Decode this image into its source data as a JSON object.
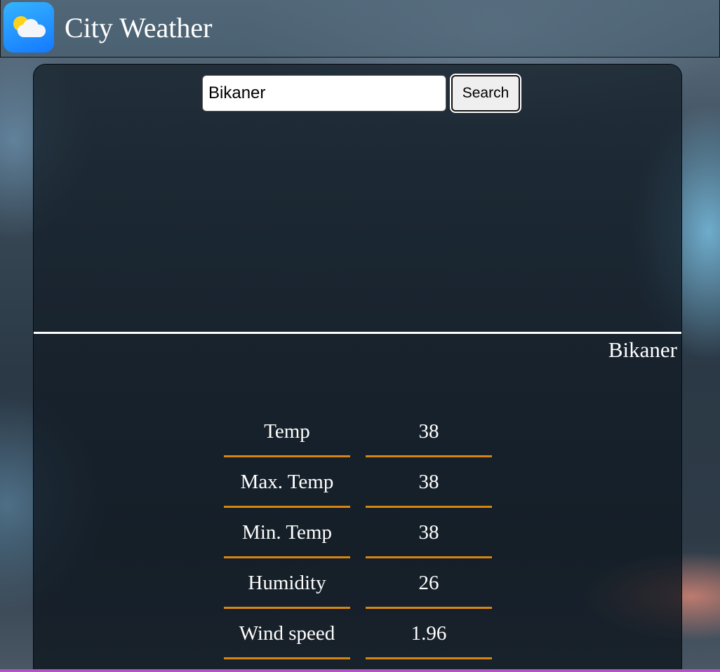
{
  "app": {
    "title": "City Weather"
  },
  "search": {
    "value": "Bikaner",
    "button_label": "Search"
  },
  "weather": {
    "city": "Bikaner",
    "rows": [
      {
        "label": "Temp",
        "value": "38"
      },
      {
        "label": "Max. Temp",
        "value": "38"
      },
      {
        "label": "Min. Temp",
        "value": "38"
      },
      {
        "label": "Humidity",
        "value": "26"
      },
      {
        "label": "Wind speed",
        "value": "1.96"
      }
    ]
  },
  "icons": {
    "app_icon": "weather-sun-cloud-icon"
  },
  "colors": {
    "accent_underline": "#d9850f",
    "app_icon_blue": "#1f8fff",
    "divider": "#ffffff"
  }
}
